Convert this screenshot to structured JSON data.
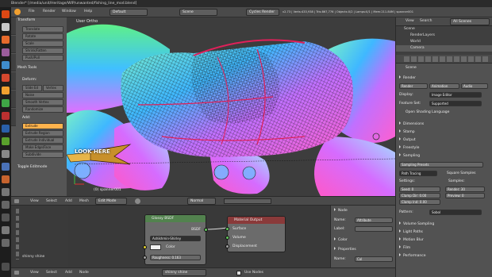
{
  "topbar": {
    "title": "Blender* [/media/unit/Heritage/WIP/unwanted/fishing_line_mod.blend]"
  },
  "menubar": {
    "items": [
      "File",
      "Render",
      "Window",
      "Help"
    ],
    "layout": "Default",
    "scene": "Scene",
    "engine": "Cycles Render",
    "stats": "v2.73 | Verts:433,938 | Tris:867,776 | Objects:0/2 | Lamps:0/1 | Mem:211.84M | spanner001"
  },
  "toolshelf": {
    "transform_header": "Transform",
    "transform": [
      "Translate",
      "Rotate",
      "Scale",
      "Shrink/Fatten",
      "Push/Pull"
    ],
    "mesh_tools_header": "Mesh Tools",
    "deform_label": "Deform:",
    "deform": [
      "Slide Ed",
      "Vertex",
      "Noise",
      "Smooth Vertex",
      "Randomize"
    ],
    "add_label": "Add:",
    "add": [
      "Extrude",
      "Extrude Region",
      "Extrude Individual",
      "Make Edge/Face",
      "Subdivide"
    ],
    "toggle": "Toggle Editmode"
  },
  "viewport": {
    "title": "User Ortho",
    "object": "(0) spanner001",
    "caption": "LOOK HERE"
  },
  "view3d_header": {
    "items": [
      "View",
      "Select",
      "Add",
      "Mesh"
    ],
    "mode": "Edit Mode",
    "shading": "Normal"
  },
  "outliner": {
    "items": [
      "View",
      "Search"
    ],
    "filter": "All Scenes",
    "rows": [
      "Scene",
      "RenderLayers",
      "World",
      "Camera"
    ]
  },
  "properties": {
    "scene": "Scene",
    "render_label": "Render",
    "render_buttons": [
      "Render",
      "Animation",
      "Audio"
    ],
    "display_label": "Display:",
    "display_value": "Image Editor",
    "feature_label": "Feature Set:",
    "feature_value": "Supported",
    "osl": "Open Shading Language",
    "panels": [
      "Dimensions",
      "Stamp",
      "Output",
      "Freestyle",
      "Sampling"
    ],
    "sampling_presets": "Sampling Presets",
    "integrator": "Path Tracing",
    "square": "Square Samples",
    "settings_label": "Settings:",
    "samples_label": "Samples:",
    "seed": "Seed: 0",
    "clamp_direct": "Clamp Dir: 0.00",
    "clamp_indirect": "Clamp Ind: 0.00",
    "render_samples": "Render: 30",
    "preview_samples": "Preview: 0",
    "pattern_label": "Pattern:",
    "pattern_value": "Sobol",
    "bottom_panels": [
      "Volume Sampling",
      "Light Paths",
      "Motion Blur",
      "Film",
      "Performance"
    ]
  },
  "nodes": {
    "glossy_title": "Glossy BSDF",
    "glossy_out": "BSDF",
    "distribution": "Ashikhmin-Shirley",
    "color": "Color",
    "roughness": "Roughness: 0.163",
    "output_title": "Material Output",
    "output_inputs": [
      "Surface",
      "Volume",
      "Displacement"
    ]
  },
  "node_left": {
    "label": "shinny shine"
  },
  "node_props": {
    "node_header": "Node",
    "name_label": "Name:",
    "name_value": "Attribute",
    "label_label": "Label:",
    "color": "Color",
    "properties": "Properties",
    "prop_name_label": "Name:",
    "prop_name_value": "Col"
  },
  "node_header": {
    "items": [
      "View",
      "Select",
      "Add",
      "Node"
    ],
    "material": "shinny shine",
    "use_nodes": "Use Nodes"
  },
  "colors": {
    "accent": "#5680c2",
    "orange": "#f0a030",
    "wire_red": "#e0205a"
  }
}
